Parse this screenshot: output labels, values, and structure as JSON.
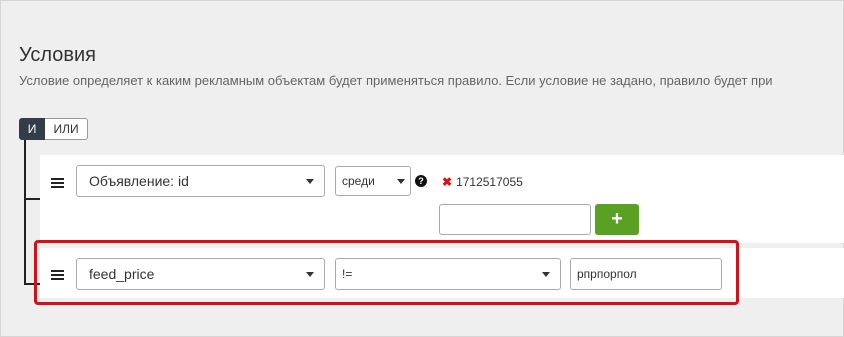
{
  "section": {
    "title": "Условия",
    "subtitle": "Условие определяет к каким рекламным объектам будет применяться правило. Если условие не задано, правило будет при"
  },
  "logic": {
    "and_label": "И",
    "or_label": "ИЛИ",
    "selected": "И"
  },
  "conditions": [
    {
      "field": "Объявление: id",
      "operator": "среди",
      "values": [
        "1712517055"
      ],
      "new_value": "",
      "add_label": "+"
    },
    {
      "field": "feed_price",
      "operator": "!=",
      "value": "рпрпорпол"
    }
  ],
  "icons": {
    "handle": "drag-handle-icon",
    "help": "question-circle-icon",
    "remove": "remove-x-icon",
    "dropdown": "caret-down-icon"
  },
  "colors": {
    "accent_dark": "#333c48",
    "add_button": "#5aa023",
    "highlight": "#d20f1a",
    "remove": "#dd1111"
  }
}
